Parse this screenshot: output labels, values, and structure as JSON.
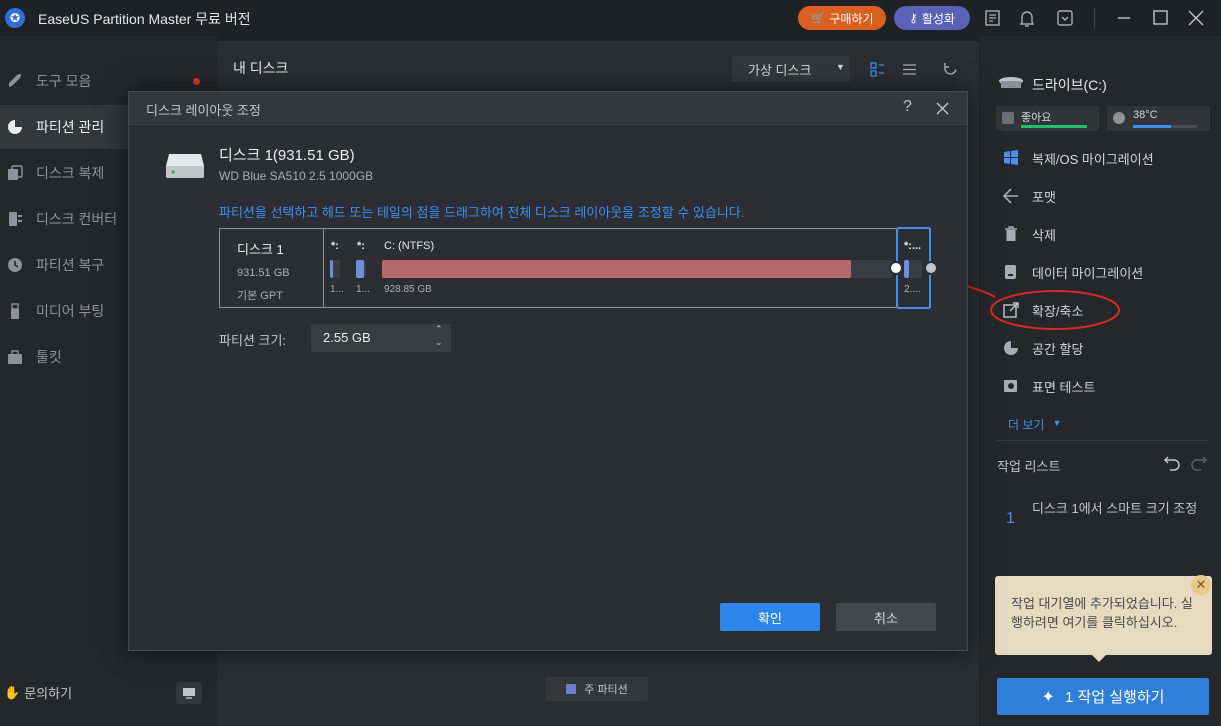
{
  "app": {
    "title": "EaseUS Partition Master 무료 버전"
  },
  "titlebar": {
    "buy_label": "구매하기",
    "activate_label": "활성화"
  },
  "sidebar": {
    "items": [
      {
        "label": "도구 모음"
      },
      {
        "label": "파티션 관리"
      },
      {
        "label": "디스크 복제"
      },
      {
        "label": "디스크 컨버터"
      },
      {
        "label": "파티션 복구"
      },
      {
        "label": "미디어 부팅"
      },
      {
        "label": "툴킷"
      }
    ],
    "contact_label": "문의하기"
  },
  "main": {
    "heading": "내 디스크",
    "view_select": "가상 디스크",
    "legend_primary": "주 파티션"
  },
  "right": {
    "drive_title": "드라이브(C:)",
    "health": "좋아요",
    "temperature": "38°C",
    "actions": [
      {
        "label": "복제/OS 마이그레이션"
      },
      {
        "label": "포맷"
      },
      {
        "label": "삭제"
      },
      {
        "label": "데이터 마이그레이션"
      },
      {
        "label": "확장/축소"
      },
      {
        "label": "공간 할당"
      },
      {
        "label": "표면 테스트"
      }
    ],
    "more_label": "더 보기",
    "task_header": "작업 리스트",
    "task_number": "1",
    "task_text": "디스크 1에서 스마트 크기 조정",
    "tooltip_text": "작업 대기열에 추가되었습니다. 실행하려면 여기를 클릭하십시오.",
    "execute_label": "1 작업 실행하기"
  },
  "dialog": {
    "title": "디스크 레이아웃 조정",
    "disk_name": "디스크 1(931.51 GB)",
    "disk_model": "WD Blue SA510 2.5 1000GB",
    "instruction": "파티션을 선택하고 헤드 또는 테일의 점을 드래그하여 전체 디스크 레이아웃을 조정할 수 있습니다.",
    "disk_info": {
      "name": "디스크 1",
      "size": "931.51 GB",
      "type": "기본 GPT"
    },
    "partitions": [
      {
        "label": "*:",
        "size": "1...",
        "fill": 0.3
      },
      {
        "label": "*:",
        "size": "1...",
        "fill": 0.8
      },
      {
        "label": "C: (NTFS)",
        "size": "928.85 GB",
        "fill": 0.92
      },
      {
        "label": "*:...",
        "size": "2....",
        "fill": 0.3
      }
    ],
    "size_label": "파티션 크기:",
    "size_value": "2.55 GB",
    "ok_label": "확인",
    "cancel_label": "취소"
  },
  "colors": {
    "accent": "#3b8ff0",
    "used": "#b5696b",
    "annotation": "#d42a20"
  }
}
